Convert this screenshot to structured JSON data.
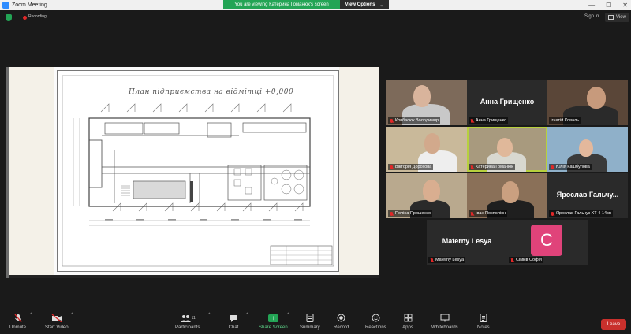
{
  "window": {
    "title": "Zoom Meeting",
    "controls": [
      "—",
      "☐",
      "✕"
    ]
  },
  "share_banner": {
    "message": "You are viewing Катерина Гоманюк's screen",
    "options_label": "View Options",
    "options_caret": "⌄"
  },
  "topbar": {
    "recording_label": "Recording",
    "sign_in": "Sign in",
    "view_label": "View"
  },
  "shared_screen": {
    "plan_title": "План підприємства на відмітці +0,000"
  },
  "participants": [
    {
      "name": "Ковбасюк Володимир",
      "muted": true,
      "video": true
    },
    {
      "name": "Анна Грищенко",
      "display": "Анна Грищенко",
      "muted": true,
      "video": false
    },
    {
      "name": "Ігнатій Коваль",
      "muted": false,
      "video": true
    },
    {
      "name": "Вікторія Дорохова",
      "muted": true,
      "video": true
    },
    {
      "name": "Катерина Гоманюк",
      "muted": true,
      "video": true,
      "active": true
    },
    {
      "name": "Юлія Кашбулова",
      "muted": true,
      "video": true
    },
    {
      "name": "Поліна Прошенко",
      "muted": true,
      "video": true
    },
    {
      "name": "Іван Посполіон",
      "muted": true,
      "video": true
    },
    {
      "name": "Ярослав Гальчук ХТ 4-14сп",
      "display": "Ярослав Гальчу...",
      "muted": true,
      "video": false
    },
    {
      "name": "Materny Lesya",
      "display": "Materny Lesya",
      "muted": true,
      "video": false
    },
    {
      "name": "Сімків Софія",
      "initial": "C",
      "muted": true,
      "video": false
    }
  ],
  "toolbar": {
    "unmute": "Unmute",
    "start_video": "Start Video",
    "participants": "Participants",
    "participants_count": "11",
    "chat": "Chat",
    "share_screen": "Share Screen",
    "summary": "Summary",
    "record": "Record",
    "reactions": "Reactions",
    "apps": "Apps",
    "whiteboards": "Whiteboards",
    "notes": "Notes",
    "leave": "Leave"
  },
  "colors": {
    "accent_green": "#23a455",
    "leave_red": "#c9302c",
    "avatar_pink": "#e0437a",
    "active_outline": "#b7d03e"
  }
}
